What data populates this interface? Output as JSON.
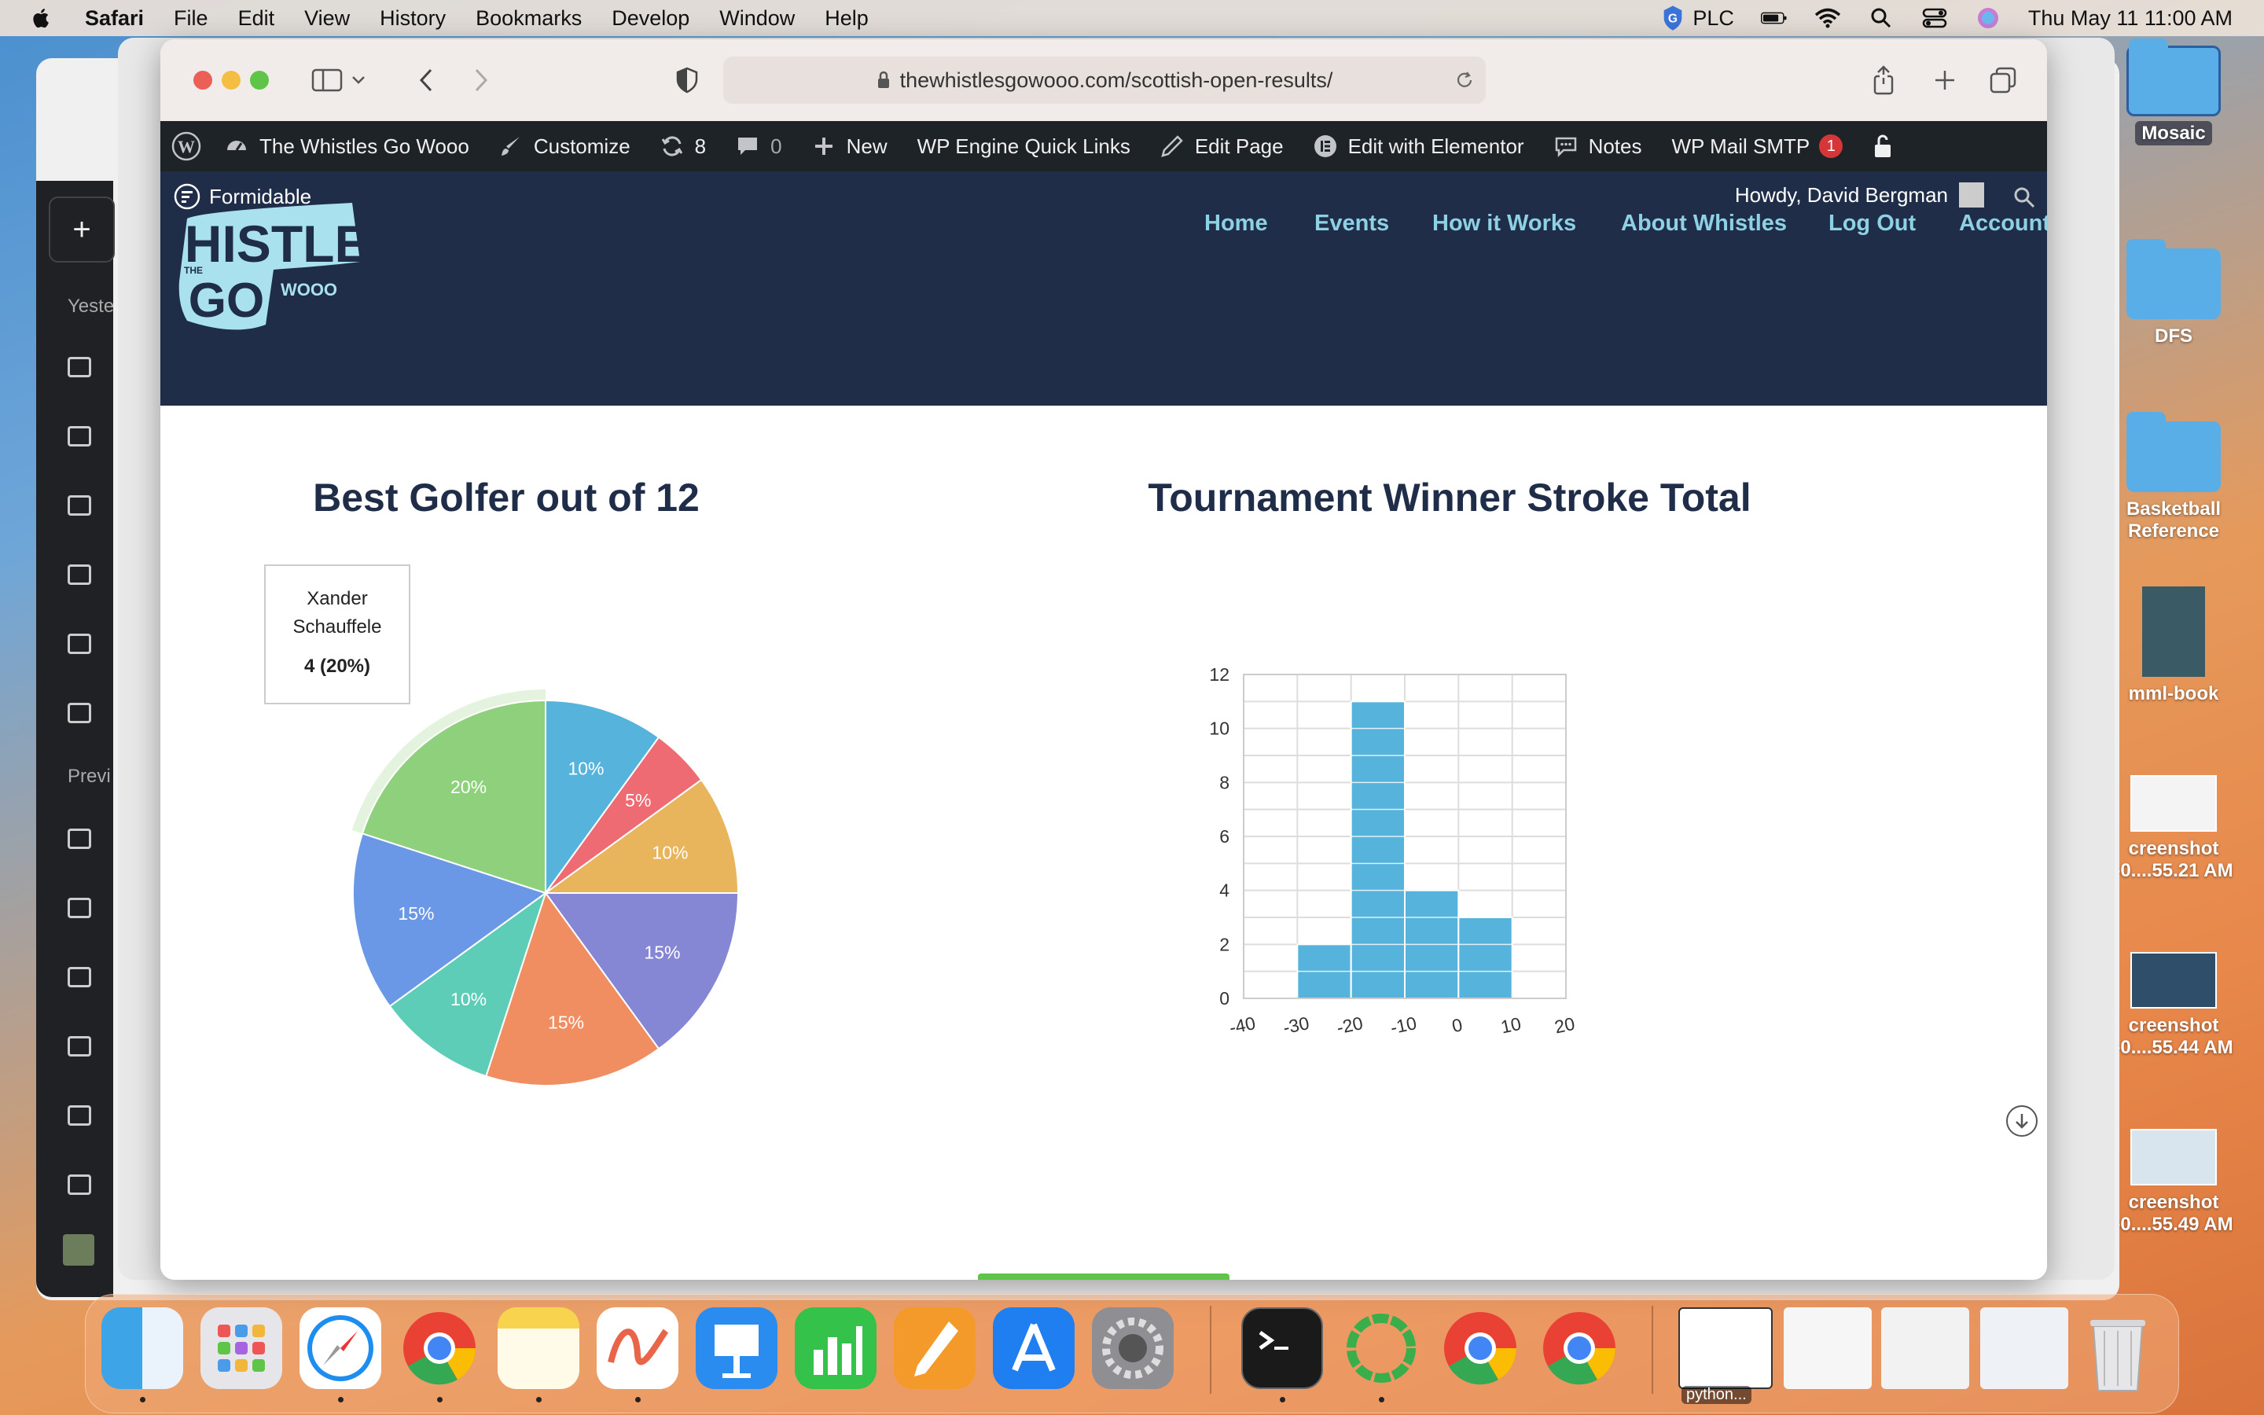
{
  "menubar": {
    "app": "Safari",
    "items": [
      "File",
      "Edit",
      "View",
      "History",
      "Bookmarks",
      "Develop",
      "Window",
      "Help"
    ],
    "vpn": "PLC",
    "datetime": "Thu May 11  11:00 AM"
  },
  "desktop": {
    "items": [
      "Mosaic",
      "DFS",
      "Basketball Reference",
      "mml-book",
      "creenshot -0....55.21 AM",
      "creenshot -0....55.44 AM",
      "creenshot -0....55.49 AM"
    ]
  },
  "sidebar_bg": {
    "yesterday": "Yeste",
    "previous": "Previ"
  },
  "browser": {
    "url": "thewhistlesgowooo.com/scottish-open-results/"
  },
  "wpbar": {
    "site": "The Whistles Go Wooo",
    "customize": "Customize",
    "updates": "8",
    "comments": "0",
    "new": "New",
    "wpengine": "WP Engine Quick Links",
    "edit_page": "Edit Page",
    "elementor": "Edit with Elementor",
    "notes": "Notes",
    "smtp": "WP Mail SMTP",
    "smtp_count": "1"
  },
  "site": {
    "formidable": "Formidable",
    "logo_text_top": "WHISTLES",
    "logo_text_bottom": "GO",
    "logo_text_small": "WOOO",
    "logo_text_the": "THE",
    "howdy": "Howdy, David Bergman",
    "nav": [
      "Home",
      "Events",
      "How it Works",
      "About Whistles",
      "Log Out",
      "Account"
    ]
  },
  "pie": {
    "title": "Best Golfer out of 12",
    "tooltip_name": "Xander Schauffele",
    "tooltip_value": "4 (20%)",
    "slices": [
      {
        "pct": 10,
        "label": "10%",
        "color": "#56b4dc"
      },
      {
        "pct": 5,
        "label": "5%",
        "color": "#ef6b73"
      },
      {
        "pct": 10,
        "label": "10%",
        "color": "#e8b45c"
      },
      {
        "pct": 15,
        "label": "15%",
        "color": "#8687d4"
      },
      {
        "pct": 15,
        "label": "15%",
        "color": "#f08e62"
      },
      {
        "pct": 10,
        "label": "10%",
        "color": "#5ecdb8"
      },
      {
        "pct": 15,
        "label": "15%",
        "color": "#6b98e6"
      },
      {
        "pct": 20,
        "label": "20%",
        "color": "#8ed07c"
      }
    ]
  },
  "chart_data": {
    "type": "bar",
    "title": "Tournament Winner Stroke Total",
    "bin_edges": [
      -30,
      -20,
      -10,
      0,
      10
    ],
    "values": [
      2,
      11,
      4,
      3
    ],
    "xticks": [
      "-40",
      "-30",
      "-20",
      "-10",
      "0",
      "10",
      "20"
    ],
    "yticks": [
      "0",
      "2",
      "4",
      "6",
      "8",
      "10",
      "12"
    ],
    "xlim": [
      -40,
      20
    ],
    "ylim": [
      0,
      12
    ],
    "grid": true,
    "color": "#56b4dc"
  },
  "dock": {
    "python_label": "python..."
  }
}
